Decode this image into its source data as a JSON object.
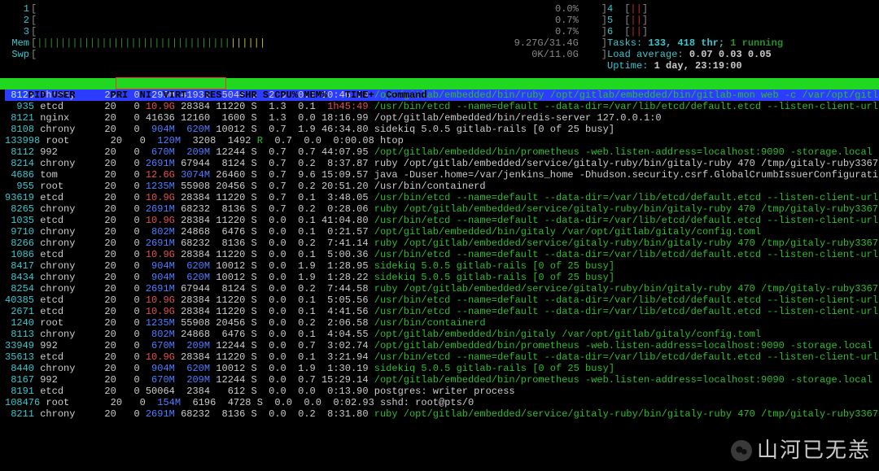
{
  "meters": {
    "cpu": [
      {
        "idx": "1",
        "bars": "[",
        "pct": "0.0%"
      },
      {
        "idx": "2",
        "bars": "[",
        "pct": "0.7%"
      },
      {
        "idx": "3",
        "bars": "[",
        "pct": "0.7%"
      }
    ],
    "mem": {
      "label": "Mem",
      "value": "9.27G/31.4G"
    },
    "swp": {
      "label": "Swp",
      "value": "0K/11.0G"
    },
    "small": [
      {
        "idx": "4"
      },
      {
        "idx": "5"
      },
      {
        "idx": "6"
      }
    ]
  },
  "stats": {
    "tasks_label": "Tasks: ",
    "tasks_num": "133",
    "tasks_thr": ", 418 thr; ",
    "tasks_running": "1 running",
    "load_label": "Load average: ",
    "load_vals": [
      "0.07",
      "0.03",
      "0.05"
    ],
    "uptime_label": "Uptime: ",
    "uptime_val": "1 day, 23:19:00"
  },
  "header": {
    "cols": "  PID USER      PRI  NI  VIRT   RES   SHR S CPU% MEM%   TIME+  Command"
  },
  "processes": [
    {
      "pid": "8125",
      "user": "chrony",
      "pri": "20",
      "ni": "0",
      "virt": "299M",
      "res": "41936",
      "shr": "5044",
      "s": "S",
      "cpu": "2.0",
      "mem": "0.1",
      "time": "10:46.79",
      "cmd": "/opt/gitlab/embedded/bin/ruby /opt/gitlab/embedded/bin/gitlab-mon web -c /var/opt/gitl",
      "hl": true,
      "virt_c": "blue",
      "cmd_c": "green"
    },
    {
      "pid": "935",
      "user": "etcd",
      "pri": "20",
      "ni": "0",
      "virt": "10.9G",
      "res": "28384",
      "shr": "11220",
      "s": "S",
      "cpu": "1.3",
      "mem": "0.1",
      "time": "1h45:49",
      "cmd": "/usr/bin/etcd --name=default --data-dir=/var/lib/etcd/default.etcd --listen-client-url",
      "virt_c": "red",
      "cmd_c": "green",
      "time_c": "red"
    },
    {
      "pid": "8121",
      "user": "nginx",
      "pri": "20",
      "ni": "0",
      "virt": "41636",
      "res": "12160",
      "shr": "1600",
      "s": "S",
      "cpu": "1.3",
      "mem": "0.0",
      "time": "18:16.99",
      "cmd": "/opt/gitlab/embedded/bin/redis-server 127.0.0.1:0",
      "cmd_c": "white"
    },
    {
      "pid": "8108",
      "user": "chrony",
      "pri": "20",
      "ni": "0",
      "virt": "904M",
      "res": "620M",
      "shr": "10012",
      "s": "S",
      "cpu": "0.7",
      "mem": "1.9",
      "time": "46:34.80",
      "cmd": "sidekiq 5.0.5 gitlab-rails [0 of 25 busy]",
      "virt_c": "blue",
      "res_c": "blue",
      "cmd_c": "white"
    },
    {
      "pid": "133998",
      "user": "root",
      "pri": "20",
      "ni": "0",
      "virt": "120M",
      "res": "3208",
      "shr": "1492",
      "s": "R",
      "cpu": "0.7",
      "mem": "0.0",
      "time": "0:00.08",
      "cmd": "htop",
      "virt_c": "blue",
      "s_c": "green",
      "cmd_c": "white"
    },
    {
      "pid": "8112",
      "user": "992",
      "pri": "20",
      "ni": "0",
      "virt": "670M",
      "res": "209M",
      "shr": "12244",
      "s": "S",
      "cpu": "0.7",
      "mem": "0.7",
      "time": "44:07.95",
      "cmd": "/opt/gitlab/embedded/bin/prometheus -web.listen-address=localhost:9090 -storage.local",
      "virt_c": "blue",
      "res_c": "blue",
      "cmd_c": "green"
    },
    {
      "pid": "8214",
      "user": "chrony",
      "pri": "20",
      "ni": "0",
      "virt": "2691M",
      "res": "67944",
      "shr": "8124",
      "s": "S",
      "cpu": "0.7",
      "mem": "0.2",
      "time": "8:37.87",
      "cmd": "ruby /opt/gitlab/embedded/service/gitaly-ruby/bin/gitaly-ruby 470 /tmp/gitaly-ruby3367",
      "virt_c": "blue",
      "cmd_c": "white"
    },
    {
      "pid": "4686",
      "user": "tom",
      "pri": "20",
      "ni": "0",
      "virt": "12.6G",
      "res": "3074M",
      "shr": "26460",
      "s": "S",
      "cpu": "0.7",
      "mem": "9.6",
      "time": "15:09.57",
      "cmd": "java -Duser.home=/var/jenkins_home -Dhudson.security.csrf.GlobalCrumbIssuerConfigurati",
      "virt_c": "red",
      "res_c": "blue",
      "cmd_c": "white"
    },
    {
      "pid": "955",
      "user": "root",
      "pri": "20",
      "ni": "0",
      "virt": "1235M",
      "res": "55908",
      "shr": "20456",
      "s": "S",
      "cpu": "0.7",
      "mem": "0.2",
      "time": "20:51.20",
      "cmd": "/usr/bin/containerd",
      "virt_c": "blue",
      "cmd_c": "white"
    },
    {
      "pid": "93619",
      "user": "etcd",
      "pri": "20",
      "ni": "0",
      "virt": "10.9G",
      "res": "28384",
      "shr": "11220",
      "s": "S",
      "cpu": "0.7",
      "mem": "0.1",
      "time": "3:48.05",
      "cmd": "/usr/bin/etcd --name=default --data-dir=/var/lib/etcd/default.etcd --listen-client-url",
      "virt_c": "red",
      "cmd_c": "green"
    },
    {
      "pid": "8265",
      "user": "chrony",
      "pri": "20",
      "ni": "0",
      "virt": "2691M",
      "res": "68232",
      "shr": "8136",
      "s": "S",
      "cpu": "0.7",
      "mem": "0.2",
      "time": "0:28.06",
      "cmd": "ruby /opt/gitlab/embedded/service/gitaly-ruby/bin/gitaly-ruby 470 /tmp/gitaly-ruby3367",
      "virt_c": "blue",
      "cmd_c": "green"
    },
    {
      "pid": "1035",
      "user": "etcd",
      "pri": "20",
      "ni": "0",
      "virt": "10.9G",
      "res": "28384",
      "shr": "11220",
      "s": "S",
      "cpu": "0.0",
      "mem": "0.1",
      "time": "41:04.80",
      "cmd": "/usr/bin/etcd --name=default --data-dir=/var/lib/etcd/default.etcd --listen-client-url",
      "virt_c": "red",
      "cmd_c": "green"
    },
    {
      "pid": "9710",
      "user": "chrony",
      "pri": "20",
      "ni": "0",
      "virt": "802M",
      "res": "24868",
      "shr": "6476",
      "s": "S",
      "cpu": "0.0",
      "mem": "0.1",
      "time": "0:21.57",
      "cmd": "/opt/gitlab/embedded/bin/gitaly /var/opt/gitlab/gitaly/config.toml",
      "virt_c": "blue",
      "cmd_c": "green"
    },
    {
      "pid": "8266",
      "user": "chrony",
      "pri": "20",
      "ni": "0",
      "virt": "2691M",
      "res": "68232",
      "shr": "8136",
      "s": "S",
      "cpu": "0.0",
      "mem": "0.2",
      "time": "7:41.14",
      "cmd": "ruby /opt/gitlab/embedded/service/gitaly-ruby/bin/gitaly-ruby 470 /tmp/gitaly-ruby3367",
      "virt_c": "blue",
      "cmd_c": "green"
    },
    {
      "pid": "1086",
      "user": "etcd",
      "pri": "20",
      "ni": "0",
      "virt": "10.9G",
      "res": "28384",
      "shr": "11220",
      "s": "S",
      "cpu": "0.0",
      "mem": "0.1",
      "time": "5:00.36",
      "cmd": "/usr/bin/etcd --name=default --data-dir=/var/lib/etcd/default.etcd --listen-client-url",
      "virt_c": "red",
      "cmd_c": "green"
    },
    {
      "pid": "8417",
      "user": "chrony",
      "pri": "20",
      "ni": "0",
      "virt": "904M",
      "res": "620M",
      "shr": "10012",
      "s": "S",
      "cpu": "0.0",
      "mem": "1.9",
      "time": "1:28.95",
      "cmd": "sidekiq 5.0.5 gitlab-rails [0 of 25 busy]",
      "virt_c": "blue",
      "res_c": "blue",
      "cmd_c": "green"
    },
    {
      "pid": "8434",
      "user": "chrony",
      "pri": "20",
      "ni": "0",
      "virt": "904M",
      "res": "620M",
      "shr": "10012",
      "s": "S",
      "cpu": "0.0",
      "mem": "1.9",
      "time": "1:28.22",
      "cmd": "sidekiq 5.0.5 gitlab-rails [0 of 25 busy]",
      "virt_c": "blue",
      "res_c": "blue",
      "cmd_c": "green"
    },
    {
      "pid": "8254",
      "user": "chrony",
      "pri": "20",
      "ni": "0",
      "virt": "2691M",
      "res": "67944",
      "shr": "8124",
      "s": "S",
      "cpu": "0.0",
      "mem": "0.2",
      "time": "7:44.58",
      "cmd": "ruby /opt/gitlab/embedded/service/gitaly-ruby/bin/gitaly-ruby 470 /tmp/gitaly-ruby3367",
      "virt_c": "blue",
      "cmd_c": "green"
    },
    {
      "pid": "40385",
      "user": "etcd",
      "pri": "20",
      "ni": "0",
      "virt": "10.9G",
      "res": "28384",
      "shr": "11220",
      "s": "S",
      "cpu": "0.0",
      "mem": "0.1",
      "time": "5:05.56",
      "cmd": "/usr/bin/etcd --name=default --data-dir=/var/lib/etcd/default.etcd --listen-client-url",
      "virt_c": "red",
      "cmd_c": "green"
    },
    {
      "pid": "2671",
      "user": "etcd",
      "pri": "20",
      "ni": "0",
      "virt": "10.9G",
      "res": "28384",
      "shr": "11220",
      "s": "S",
      "cpu": "0.0",
      "mem": "0.1",
      "time": "4:41.56",
      "cmd": "/usr/bin/etcd --name=default --data-dir=/var/lib/etcd/default.etcd --listen-client-url",
      "virt_c": "red",
      "cmd_c": "green"
    },
    {
      "pid": "1240",
      "user": "root",
      "pri": "20",
      "ni": "0",
      "virt": "1235M",
      "res": "55908",
      "shr": "20456",
      "s": "S",
      "cpu": "0.0",
      "mem": "0.2",
      "time": "2:06.58",
      "cmd": "/usr/bin/containerd",
      "virt_c": "blue",
      "cmd_c": "green"
    },
    {
      "pid": "8113",
      "user": "chrony",
      "pri": "20",
      "ni": "0",
      "virt": "802M",
      "res": "24868",
      "shr": "6476",
      "s": "S",
      "cpu": "0.0",
      "mem": "0.1",
      "time": "4:04.55",
      "cmd": "/opt/gitlab/embedded/bin/gitaly /var/opt/gitlab/gitaly/config.toml",
      "virt_c": "blue",
      "cmd_c": "green"
    },
    {
      "pid": "33949",
      "user": "992",
      "pri": "20",
      "ni": "0",
      "virt": "670M",
      "res": "209M",
      "shr": "12244",
      "s": "S",
      "cpu": "0.0",
      "mem": "0.7",
      "time": "3:02.74",
      "cmd": "/opt/gitlab/embedded/bin/prometheus -web.listen-address=localhost:9090 -storage.local",
      "virt_c": "blue",
      "res_c": "blue",
      "cmd_c": "green"
    },
    {
      "pid": "35613",
      "user": "etcd",
      "pri": "20",
      "ni": "0",
      "virt": "10.9G",
      "res": "28384",
      "shr": "11220",
      "s": "S",
      "cpu": "0.0",
      "mem": "0.1",
      "time": "3:21.94",
      "cmd": "/usr/bin/etcd --name=default --data-dir=/var/lib/etcd/default.etcd --listen-client-url",
      "virt_c": "red",
      "cmd_c": "green"
    },
    {
      "pid": "8440",
      "user": "chrony",
      "pri": "20",
      "ni": "0",
      "virt": "904M",
      "res": "620M",
      "shr": "10012",
      "s": "S",
      "cpu": "0.0",
      "mem": "1.9",
      "time": "1:30.19",
      "cmd": "sidekiq 5.0.5 gitlab-rails [0 of 25 busy]",
      "virt_c": "blue",
      "res_c": "blue",
      "cmd_c": "green"
    },
    {
      "pid": "8167",
      "user": "992",
      "pri": "20",
      "ni": "0",
      "virt": "670M",
      "res": "209M",
      "shr": "12244",
      "s": "S",
      "cpu": "0.0",
      "mem": "0.7",
      "time": "15:29.14",
      "cmd": "/opt/gitlab/embedded/bin/prometheus -web.listen-address=localhost:9090 -storage.local",
      "virt_c": "blue",
      "res_c": "blue",
      "cmd_c": "green"
    },
    {
      "pid": "8191",
      "user": "etcd",
      "pri": "20",
      "ni": "0",
      "virt": "50064",
      "res": "2384",
      "shr": "612",
      "s": "S",
      "cpu": "0.0",
      "mem": "0.0",
      "time": "0:13.90",
      "cmd": "postgres: writer process",
      "cmd_c": "white"
    },
    {
      "pid": "108476",
      "user": "root",
      "pri": "20",
      "ni": "0",
      "virt": "154M",
      "res": "6196",
      "shr": "4728",
      "s": "S",
      "cpu": "0.0",
      "mem": "0.0",
      "time": "0:02.93",
      "cmd": "sshd: root@pts/0",
      "virt_c": "blue",
      "cmd_c": "white"
    },
    {
      "pid": "8211",
      "user": "chrony",
      "pri": "20",
      "ni": "0",
      "virt": "2691M",
      "res": "68232",
      "shr": "8136",
      "s": "S",
      "cpu": "0.0",
      "mem": "0.2",
      "time": "8:31.80",
      "cmd": "ruby /opt/gitlab/embedded/service/gitaly-ruby/bin/gitaly-ruby 470 /tmp/gitaly-ruby3367",
      "virt_c": "blue",
      "cmd_c": "green"
    }
  ],
  "watermark": "山河已无恙"
}
